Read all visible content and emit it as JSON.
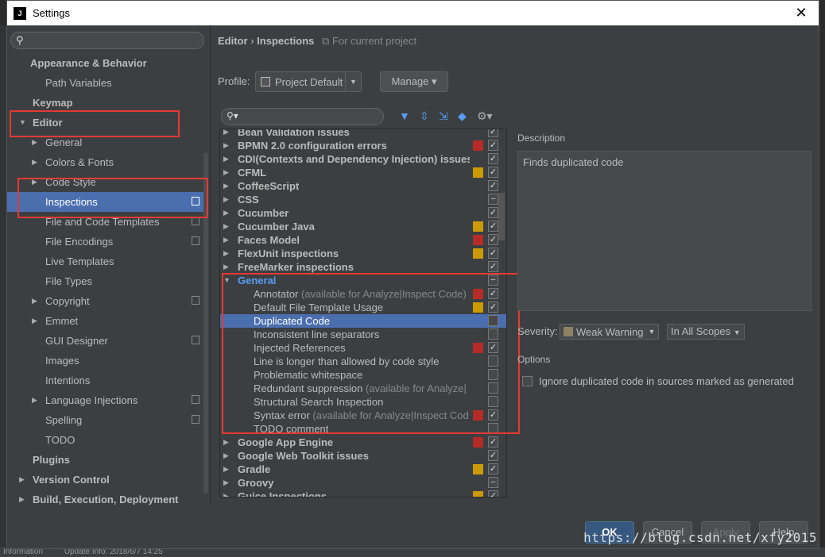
{
  "window": {
    "title": "Settings",
    "app_icon": "J"
  },
  "sidebar": {
    "items": [
      {
        "label": "Appearance & Behavior",
        "level": 0,
        "bold": true,
        "arrow": ""
      },
      {
        "label": "Path Variables",
        "level": 2,
        "bold": false,
        "arrow": ""
      },
      {
        "label": "Keymap",
        "level": 0,
        "bold": true,
        "arrow": ""
      },
      {
        "label": "Editor",
        "level": 0,
        "bold": true,
        "arrow": "▼"
      },
      {
        "label": "General",
        "level": 1,
        "bold": false,
        "arrow": "▶"
      },
      {
        "label": "Colors & Fonts",
        "level": 1,
        "bold": false,
        "arrow": "▶"
      },
      {
        "label": "Code Style",
        "level": 1,
        "bold": false,
        "arrow": "▶"
      },
      {
        "label": "Inspections",
        "level": 1,
        "bold": false,
        "arrow": "",
        "selected": true,
        "copy": true
      },
      {
        "label": "File and Code Templates",
        "level": 1,
        "bold": false,
        "arrow": "",
        "copy": true
      },
      {
        "label": "File Encodings",
        "level": 1,
        "bold": false,
        "arrow": "",
        "copy": true
      },
      {
        "label": "Live Templates",
        "level": 1,
        "bold": false,
        "arrow": ""
      },
      {
        "label": "File Types",
        "level": 1,
        "bold": false,
        "arrow": ""
      },
      {
        "label": "Copyright",
        "level": 1,
        "bold": false,
        "arrow": "▶",
        "copy": true
      },
      {
        "label": "Emmet",
        "level": 1,
        "bold": false,
        "arrow": "▶"
      },
      {
        "label": "GUI Designer",
        "level": 1,
        "bold": false,
        "arrow": "",
        "copy": true
      },
      {
        "label": "Images",
        "level": 1,
        "bold": false,
        "arrow": ""
      },
      {
        "label": "Intentions",
        "level": 1,
        "bold": false,
        "arrow": ""
      },
      {
        "label": "Language Injections",
        "level": 1,
        "bold": false,
        "arrow": "▶",
        "copy": true
      },
      {
        "label": "Spelling",
        "level": 1,
        "bold": false,
        "arrow": "",
        "copy": true
      },
      {
        "label": "TODO",
        "level": 1,
        "bold": false,
        "arrow": ""
      },
      {
        "label": "Plugins",
        "level": 0,
        "bold": true,
        "arrow": ""
      },
      {
        "label": "Version Control",
        "level": 0,
        "bold": true,
        "arrow": "▶"
      },
      {
        "label": "Build, Execution, Deployment",
        "level": 0,
        "bold": true,
        "arrow": "▶"
      }
    ]
  },
  "breadcrumb": {
    "part1": "Editor",
    "sep": "›",
    "part2": "Inspections",
    "scope": "For current project"
  },
  "profile": {
    "label": "Profile:",
    "value": "Project Default",
    "manage": "Manage"
  },
  "inspections": [
    {
      "label": "Bean Validation issues",
      "kind": "group",
      "sev": "",
      "check": "on"
    },
    {
      "label": "BPMN 2.0 configuration errors",
      "kind": "group",
      "sev": "#b52b27",
      "check": "on"
    },
    {
      "label": "CDI(Contexts and Dependency Injection) issues",
      "kind": "group",
      "sev": "",
      "check": "on"
    },
    {
      "label": "CFML",
      "kind": "group",
      "sev": "#cc9a06",
      "check": "on"
    },
    {
      "label": "CoffeeScript",
      "kind": "group",
      "sev": "",
      "check": "on"
    },
    {
      "label": "CSS",
      "kind": "group",
      "sev": "",
      "check": "part"
    },
    {
      "label": "Cucumber",
      "kind": "group",
      "sev": "",
      "check": "on"
    },
    {
      "label": "Cucumber Java",
      "kind": "group",
      "sev": "#cc9a06",
      "check": "on"
    },
    {
      "label": "Faces Model",
      "kind": "group",
      "sev": "#b52b27",
      "check": "on"
    },
    {
      "label": "FlexUnit inspections",
      "kind": "group",
      "sev": "#cc9a06",
      "check": "on"
    },
    {
      "label": "FreeMarker inspections",
      "kind": "group",
      "sev": "",
      "check": "on"
    },
    {
      "label": "General",
      "kind": "group-open",
      "sev": "",
      "check": "part"
    },
    {
      "label": "Annotator",
      "extra": " (available for Analyze|Inspect Code)",
      "kind": "child",
      "sev": "#b52b27",
      "check": "on"
    },
    {
      "label": "Default File Template Usage",
      "kind": "child",
      "sev": "#cc9a06",
      "check": "on"
    },
    {
      "label": "Duplicated Code",
      "kind": "child",
      "sev": "",
      "check": "off",
      "selected": true
    },
    {
      "label": "Inconsistent line separators",
      "kind": "child",
      "sev": "",
      "check": "off"
    },
    {
      "label": "Injected References",
      "kind": "child",
      "sev": "#b52b27",
      "check": "on"
    },
    {
      "label": "Line is longer than allowed by code style",
      "kind": "child",
      "sev": "",
      "check": "off"
    },
    {
      "label": "Problematic whitespace",
      "kind": "child",
      "sev": "",
      "check": "off"
    },
    {
      "label": "Redundant suppression",
      "extra": " (available for Analyze|",
      "kind": "child",
      "sev": "",
      "check": "off"
    },
    {
      "label": "Structural Search Inspection",
      "kind": "child",
      "sev": "",
      "check": "off"
    },
    {
      "label": "Syntax error",
      "extra": " (available for Analyze|Inspect Cod",
      "kind": "child",
      "sev": "#b52b27",
      "check": "on"
    },
    {
      "label": "TODO comment",
      "kind": "child",
      "sev": "",
      "check": "off"
    },
    {
      "label": "Google App Engine",
      "kind": "group",
      "sev": "#b52b27",
      "check": "on"
    },
    {
      "label": "Google Web Toolkit issues",
      "kind": "group",
      "sev": "",
      "check": "on"
    },
    {
      "label": "Gradle",
      "kind": "group",
      "sev": "#cc9a06",
      "check": "on"
    },
    {
      "label": "Groovy",
      "kind": "group",
      "sev": "",
      "check": "part"
    },
    {
      "label": "Guice Inspections",
      "kind": "group",
      "sev": "#cc9a06",
      "check": "on"
    }
  ],
  "details": {
    "description_label": "Description",
    "description": "Finds duplicated code",
    "severity_label": "Severity:",
    "severity_value": "Weak Warning",
    "scope_value": "In All Scopes",
    "options_label": "Options",
    "option_text": "Ignore duplicated code in sources marked as generated"
  },
  "buttons": {
    "ok": "OK",
    "cancel": "Cancel",
    "apply": "Apply",
    "help": "Help"
  },
  "status_bar": {
    "left": "Information",
    "right": "Update Info: 2018/6/7 14:25"
  },
  "watermark": "https://blog.csdn.net/xfy2015"
}
